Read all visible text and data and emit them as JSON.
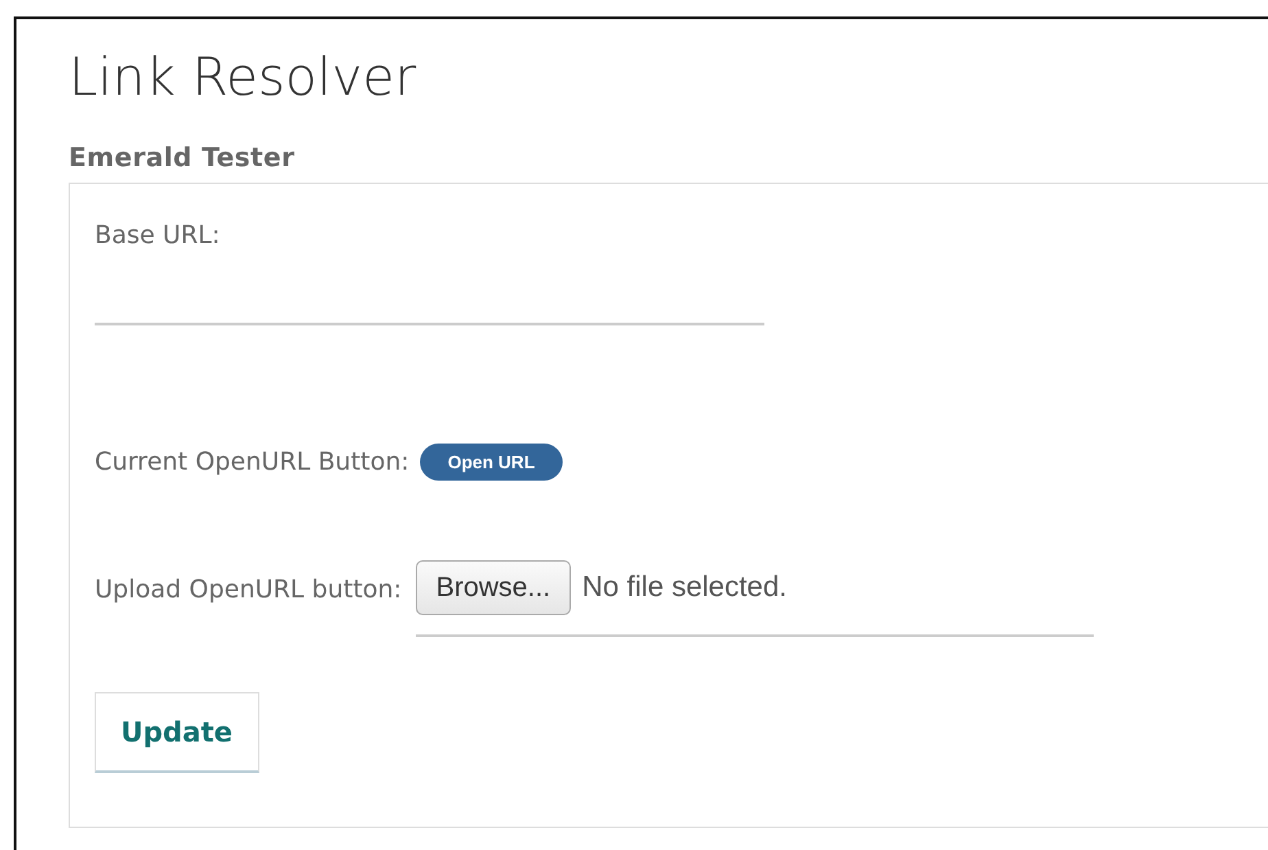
{
  "page_title": "Link Resolver",
  "section_title": "Emerald Tester",
  "form": {
    "base_url": {
      "label": "Base URL:"
    },
    "current_button": {
      "label": "Current OpenURL Button:",
      "badge": "Open URL"
    },
    "upload": {
      "label": "Upload OpenURL button:",
      "browse": "Browse...",
      "status": "No file selected."
    },
    "submit": "Update"
  }
}
